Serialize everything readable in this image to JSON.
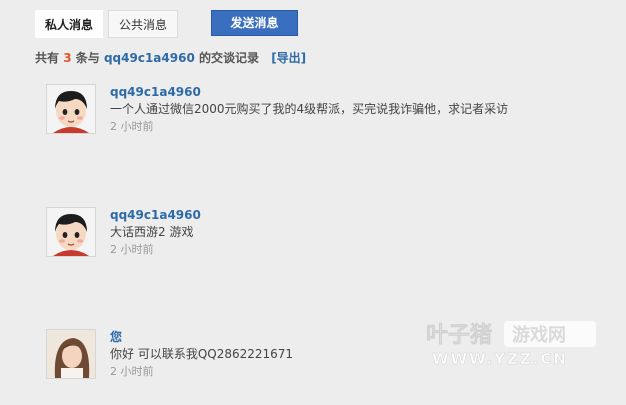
{
  "tabs": {
    "private_label": "私人消息",
    "public_label": "公共消息",
    "send_label": "发送消息"
  },
  "summary": {
    "prefix": "共有",
    "count": "3",
    "middle": "条与",
    "user": "qq49c1a4960",
    "suffix": "的交谈记录",
    "export_label": "[导出]"
  },
  "messages": [
    {
      "name": "qq49c1a4960",
      "text": "一个人通过微信2000元购买了我的4级帮派，买完说我诈骗他，求记者采访",
      "time": "2 小时前",
      "avatar": "cartoon-boy-avatar"
    },
    {
      "name": "qq49c1a4960",
      "text": "大话西游2 游戏",
      "time": "2 小时前",
      "avatar": "cartoon-boy-avatar"
    },
    {
      "name": "您",
      "text": "你好 可以联系我QQ2862221671",
      "time": "2 小时前",
      "avatar": "photo-girl-avatar"
    }
  ],
  "watermark": {
    "logo_text": "叶子猪",
    "badge_text": "游戏网",
    "url": "WWW.YZZ.CN"
  },
  "colors": {
    "accent": "#3a6fbf",
    "link": "#2d6aa7",
    "count": "#e0572c",
    "background": "#ededed"
  }
}
